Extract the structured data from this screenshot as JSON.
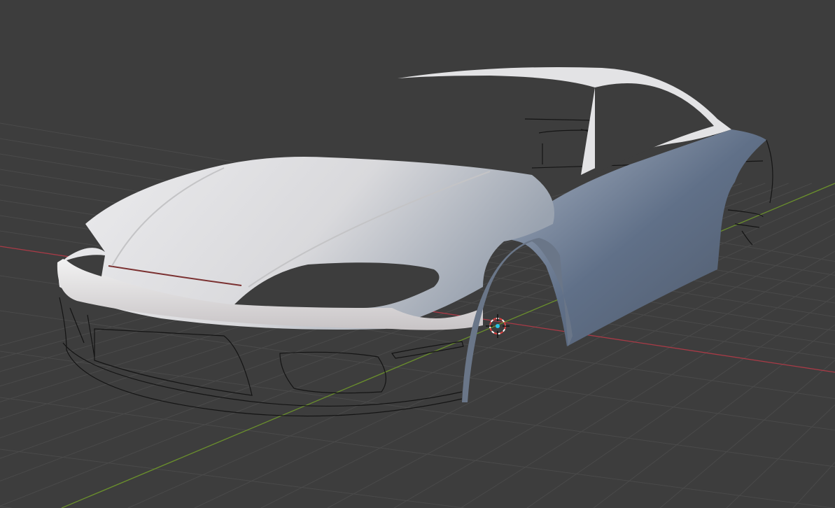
{
  "viewport": {
    "mode": "3d-viewport",
    "colors": {
      "background": "#3d3d3d",
      "grid": "#4a4a4a",
      "x_axis": "#a83a46",
      "y_axis": "#6a8f2c",
      "body_light": "#e6e6e8",
      "body_shadow": "#5d6878",
      "wireframe": "#111111",
      "cursor_red": "#e04040",
      "cursor_center": "#29c3e6"
    }
  }
}
